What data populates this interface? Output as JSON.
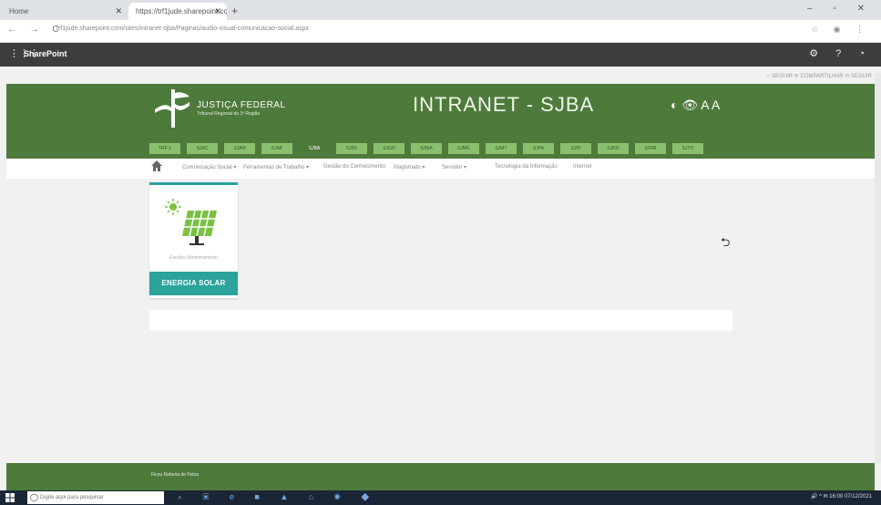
{
  "browser": {
    "tabs": [
      {
        "title": "Home"
      },
      {
        "title": "https://trf1jude.sharepoint.com"
      }
    ],
    "new_tab": "+",
    "window_controls": "– ▫ ✕",
    "nav_buttons": "← → C",
    "url": "trf1jude.sharepoint.com/sites/intranet-sjba/Paginas/audio-visual-comunicacao-social.aspx",
    "icons": "☆ ◉ ⋮"
  },
  "sharepoint": {
    "title": "SharePoint",
    "waffle": "⋮⋮⋮",
    "icons": "⚙ ? ◔"
  },
  "page_actions": "☆ SEGUIR  ⟳ COMPARTILHAR  ⟲ SEGUIR",
  "header": {
    "brand_name": "JUSTIÇA FEDERAL",
    "brand_sub": "Tribunal Regional da 1ª Região",
    "intranet_title": "INTRANET - SJBA",
    "accessibility": "◐  👁 A A"
  },
  "tiles": [
    "TRF-1",
    "SJAC",
    "SJAM",
    "SJAP",
    "SJBA",
    "SJDF",
    "SJGO",
    "SJMA",
    "SJMG",
    "SJMT",
    "SJPA",
    "SJPI",
    "SJRO",
    "SJRR",
    "SJTO"
  ],
  "menu": [
    {
      "label": "Comunicação Social ▾"
    },
    {
      "label": "Ferramentas de Trabalho ▾"
    },
    {
      "label": "Gestão do Conhecimento"
    },
    {
      "label": "Magistrado ▾"
    },
    {
      "label": "Servidor ▾"
    },
    {
      "label": "Tecnologia da Informação"
    },
    {
      "label": "Internet"
    }
  ],
  "card": {
    "subtitle": "Escolha Monitoramento",
    "button": "ENERGIA SOLAR"
  },
  "undo": "⮌",
  "footer": "Ficou Rebeira de Fotos",
  "taskbar": {
    "search_placeholder": "Digite aqui para pesquisar",
    "search_icon": "◯",
    "apps": "⌕ ▣ e ■ ▲ ⌂ ◉ ◆",
    "tray": "🔊 ^ ✉ 16:00  07/12/2021"
  },
  "colors": {
    "header_green": "#4e7a3c",
    "tile_green": "#8ac06d",
    "teal": "#2aa39b"
  }
}
